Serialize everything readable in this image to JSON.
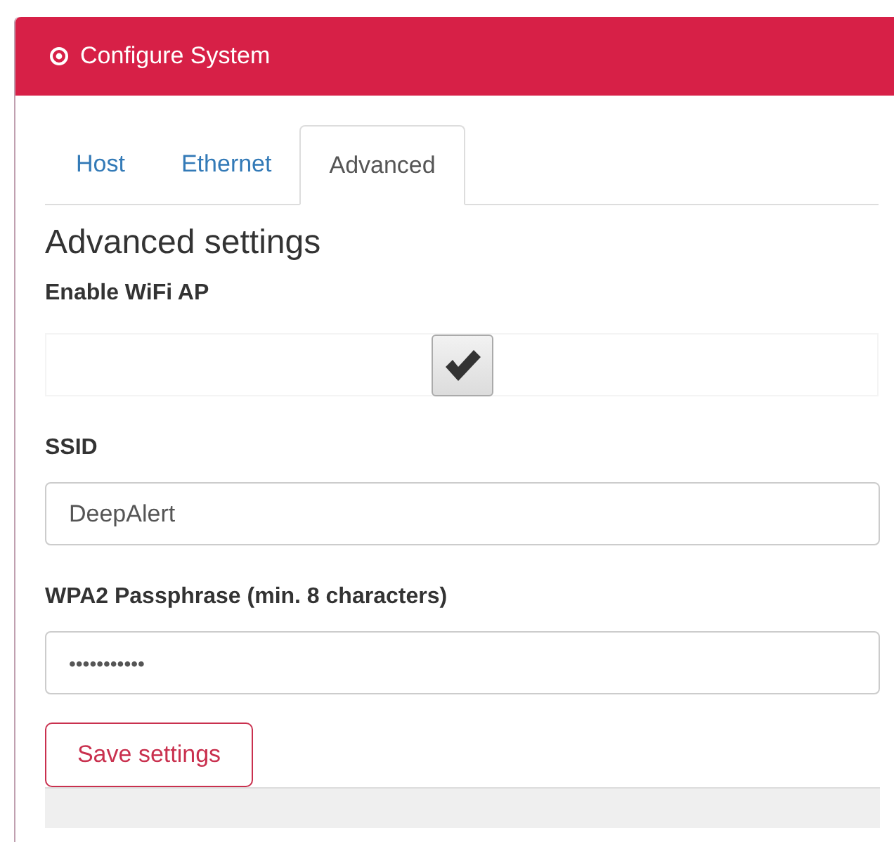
{
  "panel": {
    "title": "Configure System"
  },
  "tabs": [
    {
      "label": "Host",
      "selected": false
    },
    {
      "label": "Ethernet",
      "selected": false
    },
    {
      "label": "Advanced",
      "selected": true
    }
  ],
  "section_title": "Advanced settings",
  "wifi_ap": {
    "label": "Enable WiFi AP",
    "checked": true
  },
  "ssid": {
    "label": "SSID",
    "value": "DeepAlert"
  },
  "passphrase": {
    "label": "WPA2 Passphrase (min. 8 characters)",
    "value": "•••••••••••"
  },
  "save_button": "Save settings"
}
